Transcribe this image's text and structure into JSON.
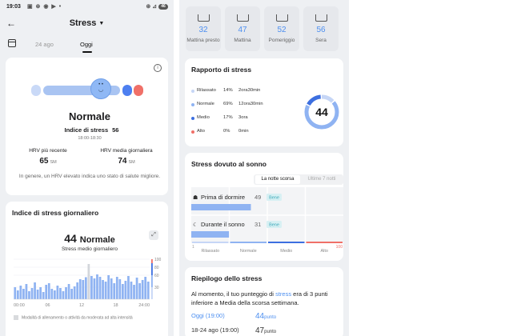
{
  "status_bar": {
    "time": "19:03",
    "icons": "▣ ⊛ ◉ ▶ •",
    "right_icons": "⊛ ⊿",
    "battery": "46"
  },
  "header": {
    "title": "Stress",
    "back_icon": "arrow-left-icon"
  },
  "date_tabs": {
    "prev": "24 ago",
    "current": "Oggi"
  },
  "summary_card": {
    "status": "Normale",
    "stress_label": "Indice di stress",
    "stress_value": "56",
    "time_range": "18:00-18:30",
    "hrv_recent_label": "HRV più recente",
    "hrv_recent_value": "65",
    "hrv_daily_label": "HRV media giornaliera",
    "hrv_daily_value": "74",
    "hrv_unit": "SM",
    "note": "In genere, un HRV elevato indica uno stato di salute migliore.",
    "meter_colors": [
      "#c9d9f7",
      "#a9c4f2",
      "#8fb8f5",
      "#4d7ff0",
      "#f07068"
    ]
  },
  "daily_card": {
    "title": "Indice di stress giornaliero",
    "score": "44",
    "score_status": "Normale",
    "avg_label": "Stress medio giornaliero",
    "x_ticks": [
      "00:00",
      "06",
      "12",
      "18",
      "24:00"
    ],
    "y_ticks": [
      "100",
      "80",
      "60",
      "30"
    ],
    "legend": "Modalità di allenamento o attività da moderata ad alta intensità"
  },
  "chart_data": {
    "type": "bar",
    "x": [
      "00:00",
      "06",
      "12",
      "18",
      "24:00"
    ],
    "xlim": [
      0,
      24
    ],
    "ylim": [
      0,
      100
    ],
    "y_ticks": [
      100,
      80,
      60,
      30
    ],
    "values": [
      30,
      22,
      34,
      26,
      38,
      20,
      28,
      42,
      24,
      30,
      18,
      36,
      40,
      26,
      22,
      34,
      28,
      20,
      30,
      38,
      26,
      32,
      42,
      50,
      48,
      55,
      60,
      58,
      52,
      62,
      56,
      48,
      44,
      60,
      52,
      40,
      56,
      50,
      38,
      46,
      58,
      44,
      36,
      54,
      40,
      48,
      56,
      44
    ],
    "highlight_index": 26,
    "highlight_value": 88
  },
  "periods": [
    {
      "value": "32",
      "label": "Mattina presto",
      "icon": "sunrise-icon"
    },
    {
      "value": "47",
      "label": "Mattina",
      "icon": "sun-horizon-icon"
    },
    {
      "value": "52",
      "label": "Pomeriggio",
      "icon": "sun-arc-icon"
    },
    {
      "value": "56",
      "label": "Sera",
      "icon": "sunset-icon"
    }
  ],
  "ratio_card": {
    "title": "Rapporto di stress",
    "rows": [
      {
        "name": "Rilassato",
        "percent": "14%",
        "duration": "2ora30min",
        "color": "#c6d6f6"
      },
      {
        "name": "Normale",
        "percent": "69%",
        "duration": "12ora30min",
        "color": "#8fb3f2"
      },
      {
        "name": "Medio",
        "percent": "17%",
        "duration": "3ora",
        "color": "#3d6fe0"
      },
      {
        "name": "Alto",
        "percent": "0%",
        "duration": "0min",
        "color": "#f07068"
      }
    ],
    "donut_value": "44",
    "donut_fractions": [
      0.14,
      0.69,
      0.17,
      0.0
    ]
  },
  "sleep_card": {
    "title": "Stress dovuto al sonno",
    "tab_active": "La notte scorsa",
    "tab_inactive": "Ultime 7 notti",
    "before_label": "Prima di dormire",
    "before_value": "49",
    "before_badge": "Bene",
    "during_label": "Durante il sonno",
    "during_value": "31",
    "during_badge": "Bene",
    "axis_start": "1",
    "axis_end": "100",
    "zones": [
      "Rilassato",
      "Normale",
      "Medio",
      "Alto"
    ],
    "zone_colors": [
      "#c6d6f6",
      "#8fb3f2",
      "#3d6fe0",
      "#f07068"
    ],
    "bar_color": "#8fb3f2"
  },
  "summary2_card": {
    "title": "Riepilogo dello stress",
    "text_a": "Al momento, il tuo punteggio di ",
    "text_hl": "stress",
    "text_b": " era di 3 punti inferiore a Media della scorsa settimana.",
    "today_label": "Oggi (19:00)",
    "today_value": "44",
    "week_label": "18-24 ago (19:00)",
    "week_value": "47",
    "unit": "punto"
  }
}
